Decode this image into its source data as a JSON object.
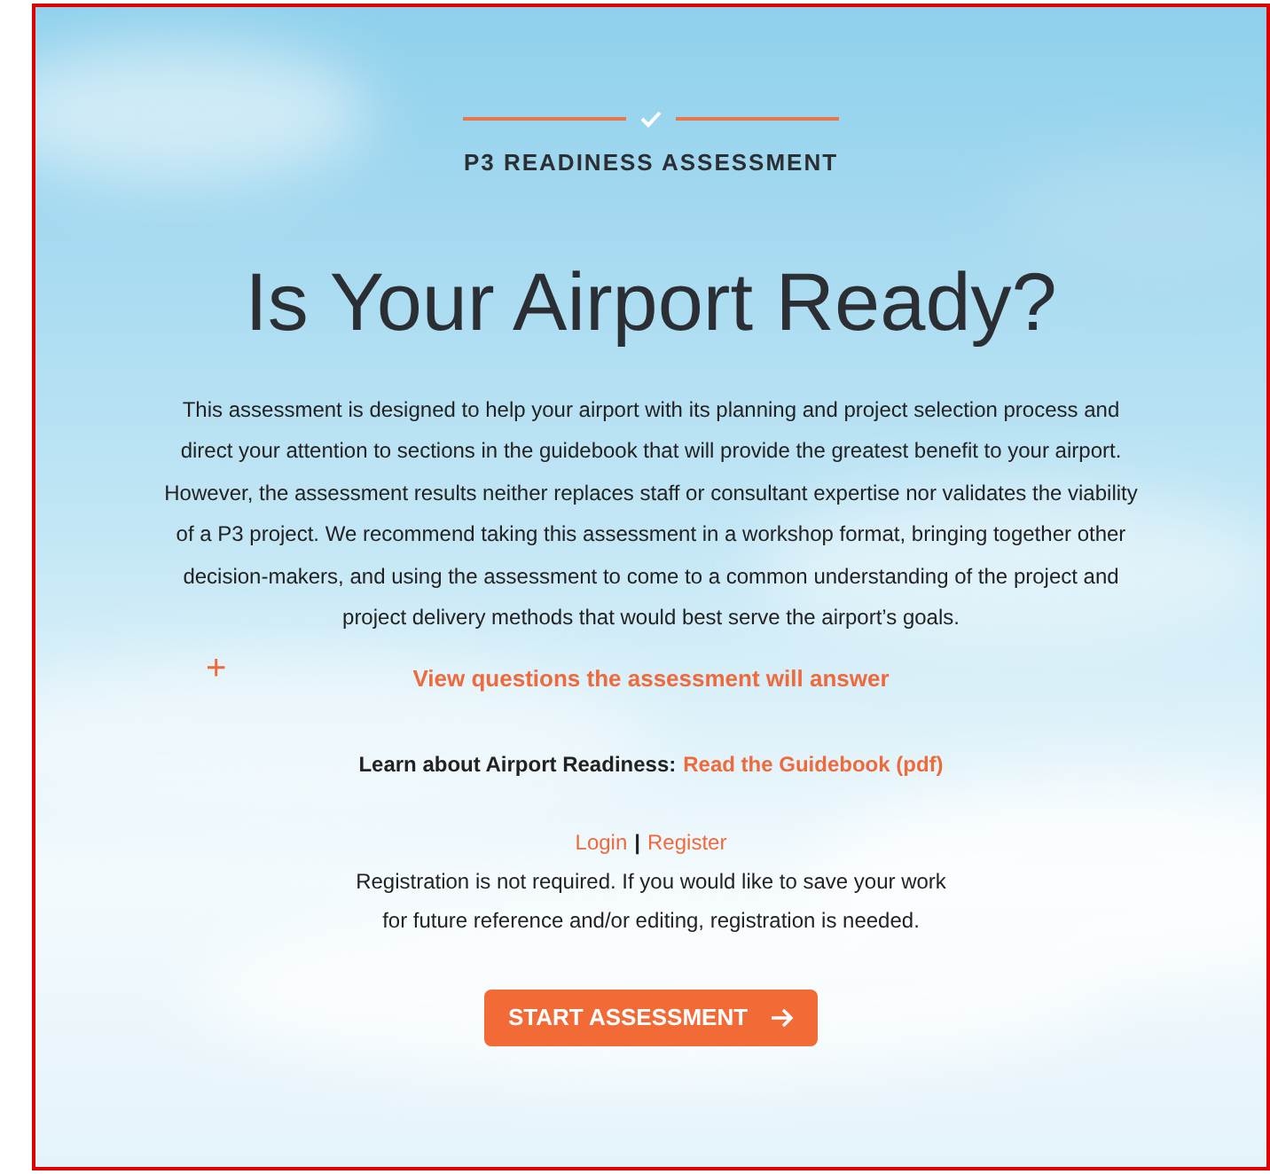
{
  "eyebrow": "P3 READINESS ASSESSMENT",
  "title": "Is Your Airport Ready?",
  "intro": "This assessment is designed to help your airport with its planning and project selection process and direct your attention to sections in the guidebook that will provide the greatest benefit to your airport. However, the assessment results neither replaces staff or consultant expertise nor validates the viability of a P3 project. We recommend taking this assessment in a workshop format, bringing together other decision-makers, and using the assessment to come to a common understanding of the project and project delivery methods that would best serve the airport’s goals.",
  "questions_toggle": {
    "icon": "+",
    "label": "View questions the assessment will answer",
    "expanded": false
  },
  "learn": {
    "text": "Learn about Airport Readiness:",
    "link": "Read the Guidebook (pdf)"
  },
  "auth": {
    "login": "Login",
    "separator": "|",
    "register": "Register"
  },
  "registration_note": "Registration is not required. If you would like to save your work for future reference and/or editing, registration is needed.",
  "start_button": "START ASSESSMENT"
}
